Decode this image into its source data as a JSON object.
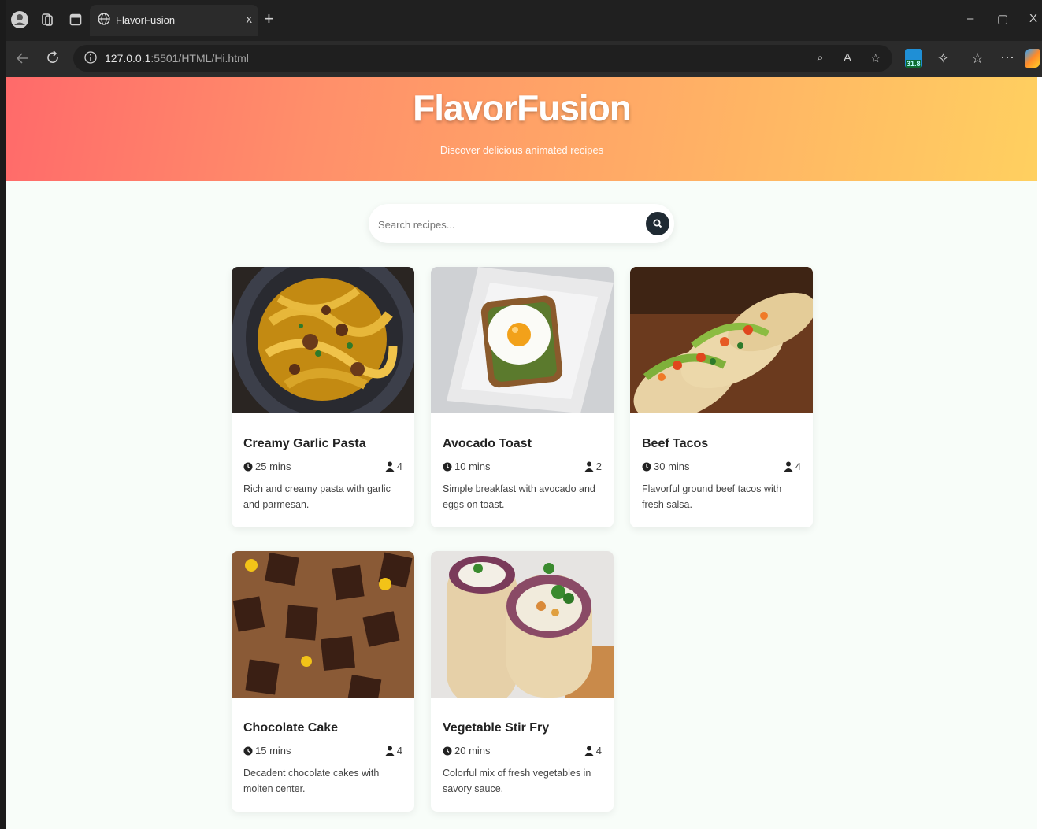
{
  "browser": {
    "tab_title": "FlavorFusion",
    "tab_close": "x",
    "new_tab": "+",
    "url_host": "127.0.0.1",
    "url_rest": ":5501/HTML/Hi.html",
    "extension_badge": "31.8",
    "window_controls": {
      "minimize": "–",
      "restore": "▢",
      "close": "X"
    }
  },
  "header": {
    "title": "FlavorFusion",
    "subtitle": "Discover delicious animated recipes"
  },
  "search": {
    "placeholder": "Search recipes..."
  },
  "recipes": [
    {
      "name": "Creamy Garlic Pasta",
      "time": "25 mins",
      "servings": "4",
      "description": "Rich and creamy pasta with garlic and parmesan."
    },
    {
      "name": "Avocado Toast",
      "time": "10 mins",
      "servings": "2",
      "description": "Simple breakfast with avocado and eggs on toast."
    },
    {
      "name": "Beef Tacos",
      "time": "30 mins",
      "servings": "4",
      "description": "Flavorful ground beef tacos with fresh salsa."
    },
    {
      "name": "Chocolate Cake",
      "time": "15 mins",
      "servings": "4",
      "description": "Decadent chocolate cakes with molten center."
    },
    {
      "name": "Vegetable Stir Fry",
      "time": "20 mins",
      "servings": "4",
      "description": "Colorful mix of fresh vegetables in savory sauce."
    }
  ],
  "colors": {
    "hero_start": "#ff6a6a",
    "hero_end": "#ffd060",
    "page_bg": "#f8fdf9",
    "search_button": "#1f2a33"
  }
}
